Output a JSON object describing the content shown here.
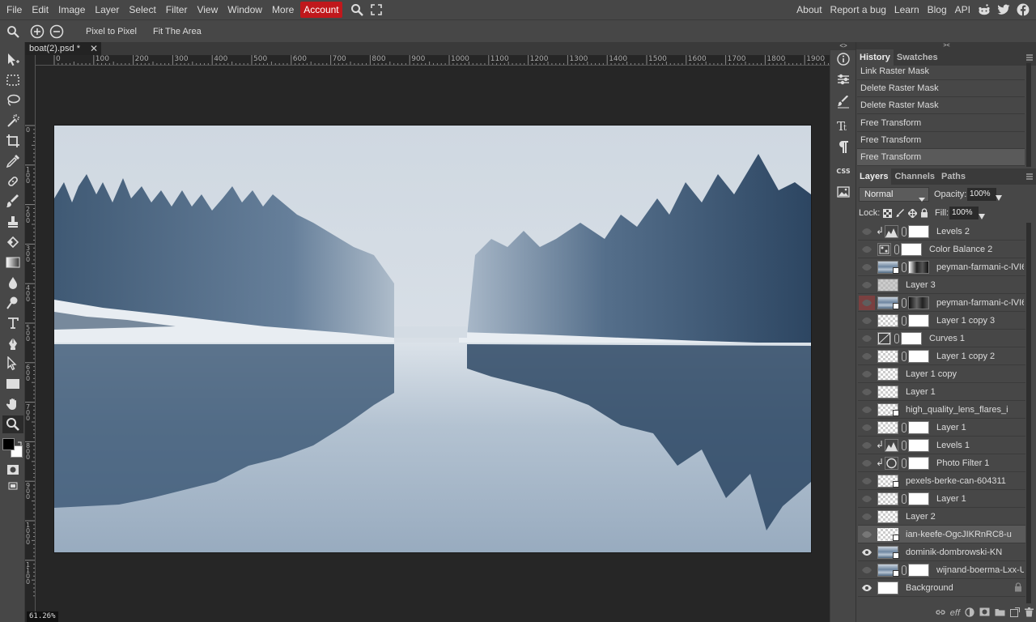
{
  "menubar": {
    "items": [
      "File",
      "Edit",
      "Image",
      "Layer",
      "Select",
      "Filter",
      "View",
      "Window",
      "More"
    ],
    "account_label": "Account",
    "right_links": [
      "About",
      "Report a bug",
      "Learn",
      "Blog",
      "API"
    ]
  },
  "options": {
    "pixel_to_pixel": "Pixel to Pixel",
    "fit_area": "Fit The Area"
  },
  "document": {
    "tab_title": "boat(2).psd *",
    "close": "✕",
    "zoom": "61.26%"
  },
  "ruler": {
    "h_labels": [
      "0",
      "100",
      "200",
      "300",
      "400",
      "500",
      "600",
      "700",
      "800",
      "900",
      "1000",
      "1100",
      "1200",
      "1300",
      "1400",
      "1500",
      "1600",
      "1700",
      "1800",
      "1900"
    ],
    "v_labels": [
      "0",
      "100",
      "200",
      "300",
      "400",
      "500",
      "600",
      "700",
      "800",
      "900",
      "1000",
      "1100"
    ]
  },
  "iconcol": {
    "css_label": "CSS"
  },
  "history": {
    "tabs": [
      "History",
      "Swatches"
    ],
    "items": [
      "Link Raster Mask",
      "Delete Raster Mask",
      "Delete Raster Mask",
      "Free Transform",
      "Free Transform",
      "Free Transform"
    ]
  },
  "layers_panel": {
    "tabs": [
      "Layers",
      "Channels",
      "Paths"
    ],
    "blend_mode": "Normal",
    "opacity_label": "Opacity:",
    "opacity_value": "100%",
    "lock_label": "Lock:",
    "fill_label": "Fill:",
    "fill_value": "100%",
    "footer_eff": "eff",
    "layers": [
      {
        "name": "Levels 2",
        "visible": false
      },
      {
        "name": "Color Balance 2",
        "visible": false
      },
      {
        "name": "peyman-farmani-c-lVI6",
        "visible": false
      },
      {
        "name": "Layer 3",
        "visible": false
      },
      {
        "name": "peyman-farmani-c-lVI6",
        "visible": false
      },
      {
        "name": "Layer 1 copy 3",
        "visible": false
      },
      {
        "name": "Curves 1",
        "visible": false
      },
      {
        "name": "Layer 1 copy 2",
        "visible": false
      },
      {
        "name": "Layer 1 copy",
        "visible": false
      },
      {
        "name": "Layer 1",
        "visible": false
      },
      {
        "name": "high_quality_lens_flares_i",
        "visible": false
      },
      {
        "name": "Layer 1",
        "visible": false
      },
      {
        "name": "Levels 1",
        "visible": false
      },
      {
        "name": "Photo Filter 1",
        "visible": false
      },
      {
        "name": "pexels-berke-can-604311",
        "visible": false
      },
      {
        "name": "Layer 1",
        "visible": false
      },
      {
        "name": "Layer 2",
        "visible": false
      },
      {
        "name": "ian-keefe-OgcJIKRnRC8-u",
        "visible": false
      },
      {
        "name": "dominik-dombrowski-KN",
        "visible": true
      },
      {
        "name": "wijnand-boerma-Lxx-U",
        "visible": false
      },
      {
        "name": "Background",
        "visible": true
      }
    ]
  },
  "colors": {
    "accent_account": "#c0181c",
    "panel_bg": "#474747",
    "workspace_bg": "#262626"
  }
}
